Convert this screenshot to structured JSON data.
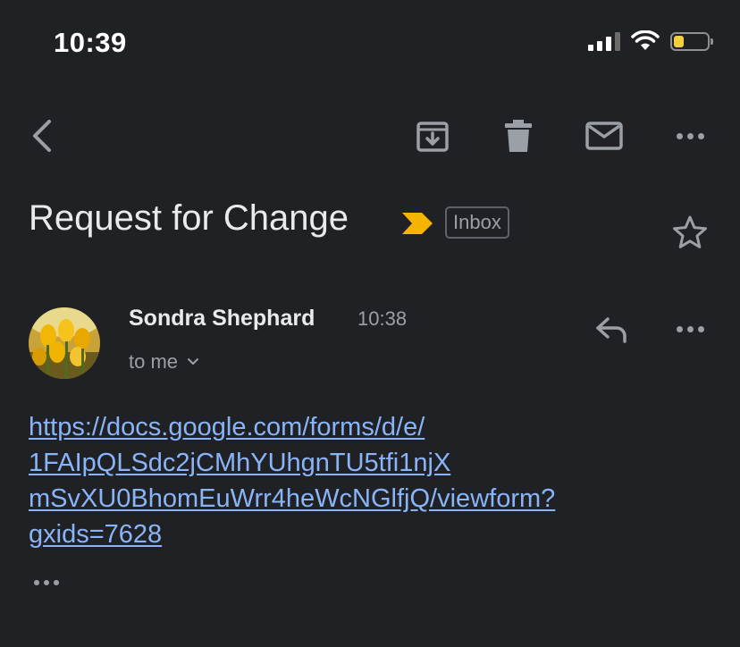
{
  "status_bar": {
    "time": "10:39",
    "battery_level": 0.3,
    "battery_color": "#f4d03f",
    "signal_bars": 3
  },
  "toolbar": {
    "icons": [
      "back-icon",
      "archive-icon",
      "trash-icon",
      "mail-icon",
      "more-icon"
    ]
  },
  "email": {
    "subject": "Request for Change",
    "label": "Inbox",
    "importance_color": "#f5b400",
    "sender_name": "Sondra Shephard",
    "time": "10:38",
    "recipient": "to me",
    "body_lines": [
      "https://docs.google.com/forms/d/e/",
      "1FAIpQLSdc2jCMhYUhgnTU5tfi1njX",
      "mSvXU0BhomEuWrr4heWcNGlfjQ/viewform?",
      "gxids=7628"
    ],
    "link_color": "#8ab4f8"
  },
  "theme": {
    "background": "#202124",
    "text_primary": "#e8eaed",
    "text_secondary": "#9aa0a6"
  }
}
